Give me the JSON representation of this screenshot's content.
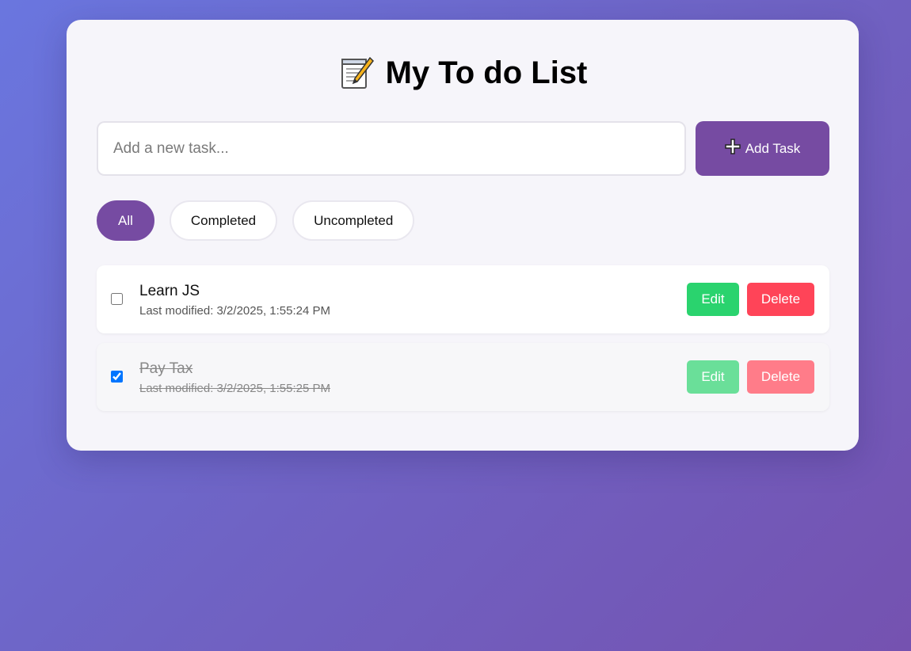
{
  "header": {
    "title": "My To do List",
    "title_icon": "memo-icon"
  },
  "new_task": {
    "placeholder": "Add a new task...",
    "value": "",
    "add_label": "Add Task",
    "add_icon": "plus-icon"
  },
  "filters": [
    {
      "label": "All",
      "active": true
    },
    {
      "label": "Completed",
      "active": false
    },
    {
      "label": "Uncompleted",
      "active": false
    }
  ],
  "tasks": [
    {
      "name": "Learn JS",
      "modified": "Last modified: 3/2/2025, 1:55:24 PM",
      "completed": false,
      "edit_label": "Edit",
      "delete_label": "Delete"
    },
    {
      "name": "Pay Tax",
      "modified": "Last modified: 3/2/2025, 1:55:25 PM",
      "completed": true,
      "edit_label": "Edit",
      "delete_label": "Delete"
    }
  ],
  "colors": {
    "accent": "#764ba2",
    "edit": "#2ad36e",
    "delete": "#ff4458"
  }
}
